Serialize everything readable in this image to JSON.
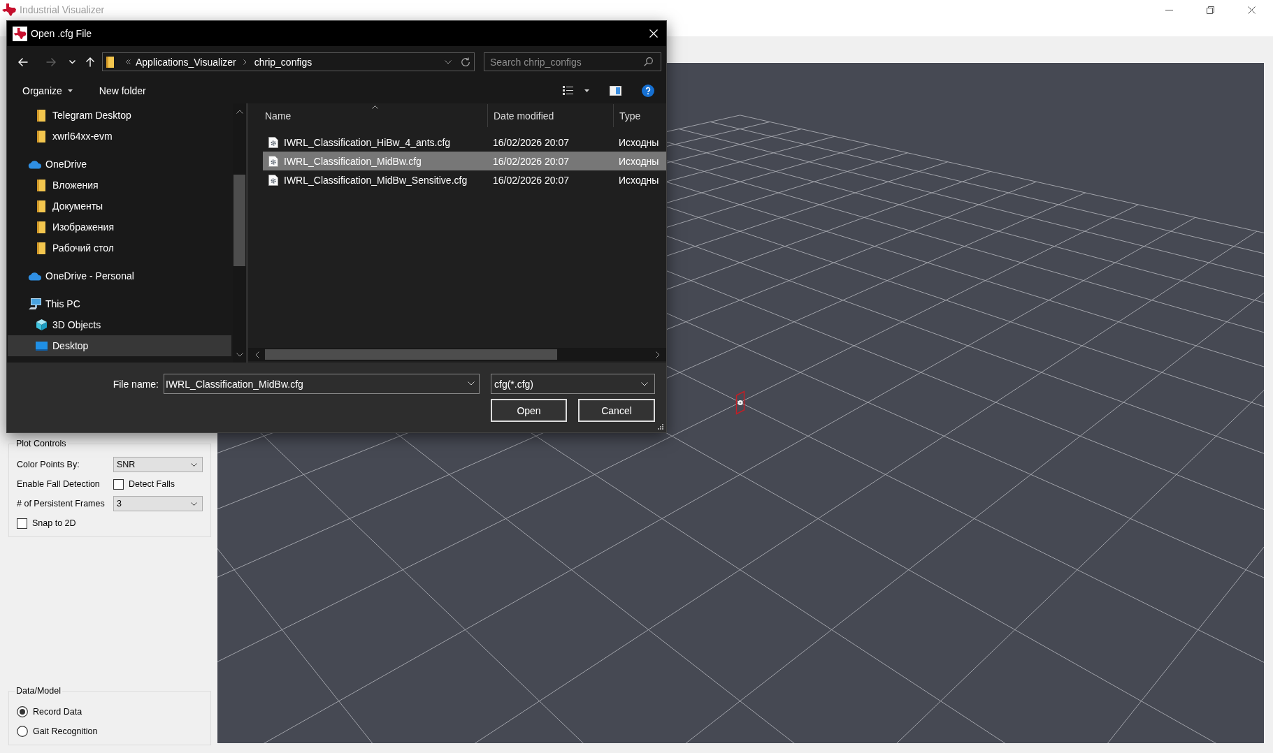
{
  "window": {
    "title": "Industrial Visualizer"
  },
  "dialog": {
    "title": "Open .cfg File",
    "nav_buttons": [
      {
        "kind": "back",
        "disabled": false
      },
      {
        "kind": "forward",
        "disabled": true
      },
      {
        "kind": "recent",
        "disabled": false
      },
      {
        "kind": "up",
        "disabled": false
      }
    ],
    "breadcrumb": [
      "Applications_Visualizer",
      "chrip_configs"
    ],
    "search": {
      "placeholder": "Search chrip_configs"
    },
    "toolbar": [
      {
        "kind": "menu",
        "label": "Organize"
      },
      {
        "kind": "button",
        "label": "New folder"
      }
    ],
    "nav_tree": [
      {
        "children": [
          {
            "kind": "folder",
            "label": "Telegram Desktop",
            "selected": false
          },
          {
            "kind": "folder",
            "label": "xwrl64xx-evm",
            "selected": false
          }
        ]
      },
      {
        "kind": "cloud",
        "label": "OneDrive",
        "selected": false,
        "children": [
          {
            "kind": "folder",
            "label": "Вложения",
            "selected": false
          },
          {
            "kind": "folder",
            "label": "Документы",
            "selected": false
          },
          {
            "kind": "folder",
            "label": "Изображения",
            "selected": false
          },
          {
            "kind": "folder",
            "label": "Рабочий стол",
            "selected": false
          }
        ]
      },
      {
        "kind": "cloud",
        "label": "OneDrive - Personal",
        "selected": false
      },
      {
        "kind": "computer",
        "label": "This PC",
        "selected": false,
        "children": [
          {
            "kind": "cube",
            "label": "3D Objects",
            "selected": false
          },
          {
            "kind": "desktop",
            "label": "Desktop",
            "selected": true
          }
        ]
      }
    ],
    "columns": [
      {
        "label": "Name",
        "sorted": true
      },
      {
        "label": "Date modified",
        "sorted": false
      },
      {
        "label": "Type",
        "sorted": false
      }
    ],
    "files": [
      {
        "name": "IWRL_Classification_HiBw_4_ants.cfg",
        "date_modified": "16/02/2026 20:07",
        "type": "Исходны",
        "selected": false
      },
      {
        "name": "IWRL_Classification_MidBw.cfg",
        "date_modified": "16/02/2026 20:07",
        "type": "Исходны",
        "selected": true
      },
      {
        "name": "IWRL_Classification_MidBw_Sensitive.cfg",
        "date_modified": "16/02/2026 20:07",
        "type": "Исходны",
        "selected": false
      }
    ],
    "file_name": {
      "label": "File name:",
      "value": "IWRL_Classification_MidBw.cfg"
    },
    "file_type": {
      "value": "cfg(*.cfg)"
    },
    "buttons": [
      "Open",
      "Cancel"
    ]
  },
  "plot_controls": {
    "title": "Plot Controls",
    "rows": [
      {
        "kind": "select",
        "label": "Color Points By:",
        "value": "SNR"
      },
      {
        "kind": "checkbox",
        "label": "Enable Fall Detection",
        "option": "Detect Falls",
        "checked": false
      },
      {
        "kind": "select",
        "label": "# of Persistent Frames",
        "value": "3"
      },
      {
        "kind": "checkbox",
        "option": "Snap to 2D",
        "checked": false
      }
    ]
  },
  "data_model": {
    "title": "Data/Model",
    "options": [
      {
        "label": "Record Data",
        "selected": true
      },
      {
        "label": "Gait Recognition",
        "selected": false
      }
    ]
  }
}
